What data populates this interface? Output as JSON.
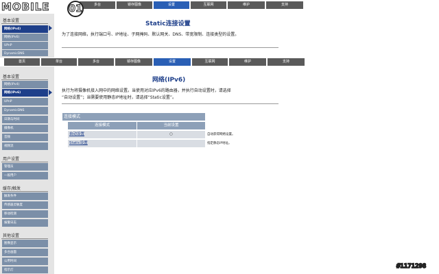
{
  "logo": {
    "text": "MOBILE",
    "circle": "01"
  },
  "top_tabs": [
    "多台",
    "镜存图像",
    "设置",
    "互联网",
    "维护",
    "支持"
  ],
  "mid_tabs": [
    "首页",
    "单台",
    "多台",
    "镜存图像",
    "设置",
    "互联网",
    "维护",
    "支持"
  ],
  "top_panel": {
    "section": "基本设置",
    "items": [
      "网络(IPv4)",
      "网络(IPv6)",
      "UPnP",
      "DynamicDNS"
    ],
    "title": "Static连接设置",
    "desc": "为了连接网络，执行端口号、IP地址、子网掩码、默认网关、DNS、带宽限制、连接类型的设置。"
  },
  "sidebar": {
    "section1": "基本设置",
    "items1": [
      "网络(IPv4)",
      "网络(IPv6)",
      "UPnP",
      "DynamicDNS",
      "日期与时间",
      "摄像机",
      "音频",
      "视频流"
    ],
    "section2": "用户设置",
    "items2": [
      "管理员",
      "一般用户"
    ],
    "section3": "缓存/触发",
    "items3": [
      "触发条件",
      "传感器灵敏度",
      "移动检测",
      "报警日志"
    ],
    "section4": "其他设置",
    "items4": [
      "图像显示",
      "多台画面",
      "公用时间",
      "指示灯"
    ]
  },
  "main": {
    "title": "网络(IPv6)",
    "desc_line1": "执行为将摄像机接入网中的网络设置。当使用对应IPv6的路由器，并执行自动设置时，请选择",
    "desc_line2": "“自动设置”；当需要使用静态IP地址时，请选择“Static设置”。",
    "table_title": "连接模式",
    "col_mode": "连接模式",
    "col_current": "当前设置",
    "rows": [
      {
        "mode": "自动设置",
        "current": "○",
        "note": "自动获得网络设置。"
      },
      {
        "mode": "Static设置",
        "current": "",
        "note": "指定静态IP地址。"
      }
    ]
  },
  "watermark": "#1171298"
}
